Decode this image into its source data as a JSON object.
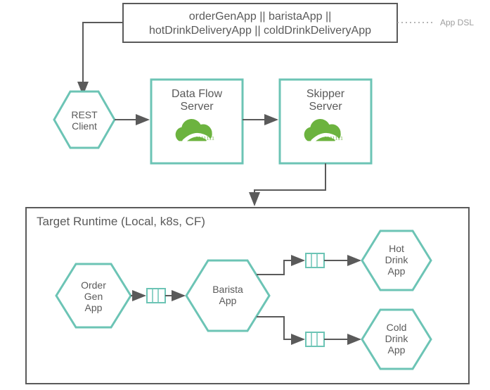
{
  "dsl": {
    "line1": "orderGenApp || baristaApp ||",
    "line2": "hotDrinkDeliveryApp || coldDrinkDeliveryApp"
  },
  "sideLabel": "App DSL",
  "restClient": {
    "l1": "REST",
    "l2": "Client"
  },
  "dataFlowServer": {
    "l1": "Data Flow",
    "l2": "Server"
  },
  "skipperServer": {
    "l1": "Skipper",
    "l2": "Server"
  },
  "runtimeTitle": "Target Runtime (Local, k8s, CF)",
  "orderGenApp": {
    "l1": "Order",
    "l2": "Gen",
    "l3": "App"
  },
  "baristaApp": {
    "l1": "Barista",
    "l2": "App"
  },
  "hotDrinkApp": {
    "l1": "Hot",
    "l2": "Drink",
    "l3": "App"
  },
  "coldDrinkApp": {
    "l1": "Cold",
    "l2": "Drink",
    "l3": "App"
  }
}
